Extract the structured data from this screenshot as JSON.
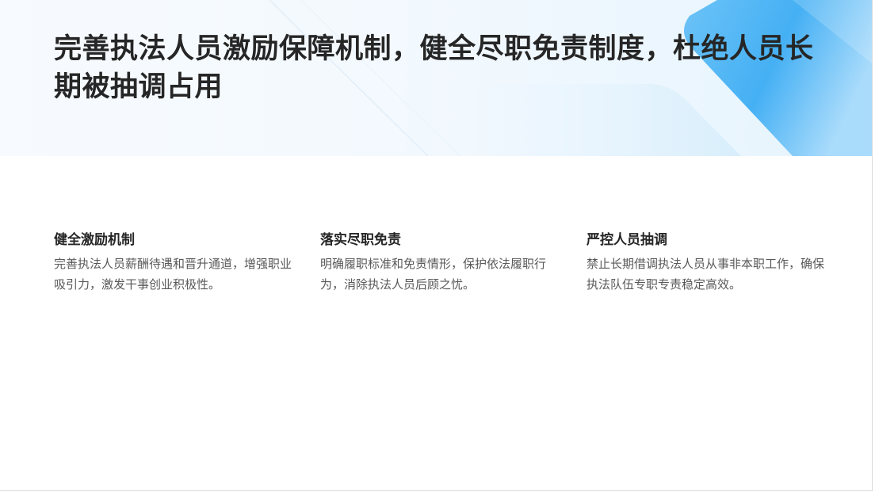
{
  "header": {
    "title": "完善执法人员激励保障机制，健全尽职免责制度，杜绝人员长期被抽调占用"
  },
  "columns": [
    {
      "heading": "健全激励机制",
      "body": "完善执法人员薪酬待遇和晋升通道，增强职业吸引力，激发干事创业积极性。"
    },
    {
      "heading": "落实尽职免责",
      "body": "明确履职标准和免责情形，保护依法履职行为，消除执法人员后顾之忧。"
    },
    {
      "heading": "严控人员抽调",
      "body": "禁止长期借调执法人员从事非本职工作，确保执法队伍专职专责稳定高效。"
    }
  ],
  "colors": {
    "accent_blue": "#4fb5f5",
    "title_text": "#262626",
    "body_text": "#595959"
  }
}
